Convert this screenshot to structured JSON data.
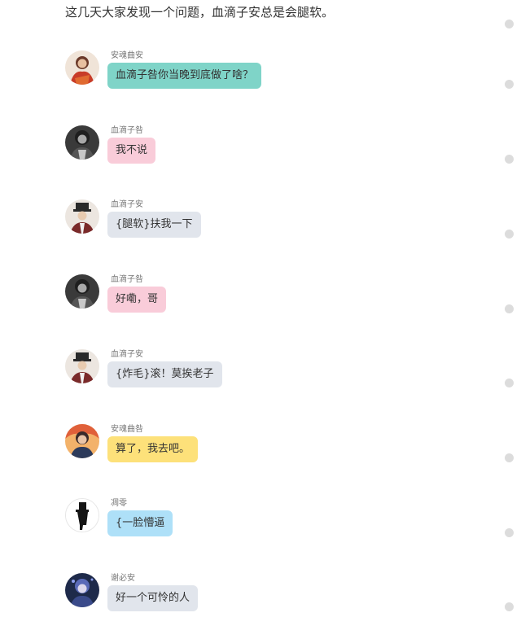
{
  "intro_text": "这几天大家发现一个问题，血滴子安总是会腿软。",
  "messages": [
    {
      "name": "安魂曲安",
      "text": "血滴子咎你当晚到底做了啥？",
      "bubble_color": "#7fd4c8",
      "avatar": "red-warrior-avatar-icon"
    },
    {
      "name": "血滴子咎",
      "text": "我不说",
      "bubble_color": "#f9ccd9",
      "avatar": "dark-figure-avatar-icon"
    },
    {
      "name": "血滴子安",
      "text": "{腿软}扶我一下",
      "bubble_color": "#e1e5ec",
      "avatar": "hat-figure-avatar-icon"
    },
    {
      "name": "血滴子咎",
      "text": "好嘞，哥",
      "bubble_color": "#f9ccd9",
      "avatar": "dark-figure-avatar-icon"
    },
    {
      "name": "血滴子安",
      "text": "{炸毛}滚！莫挨老子",
      "bubble_color": "#e1e5ec",
      "avatar": "hat-figure-avatar-icon"
    },
    {
      "name": "安魂曲咎",
      "text": "算了，我去吧。",
      "bubble_color": "#fde17a",
      "avatar": "fiery-figure-avatar-icon"
    },
    {
      "name": "凋零",
      "text": "{一脸懵逼",
      "bubble_color": "#aee0f8",
      "avatar": "silhouette-avatar-icon"
    },
    {
      "name": "谢必安",
      "text": "好一个可怜的人",
      "bubble_color": "#e1e5ec",
      "avatar": "blue-haired-avatar-icon"
    }
  ]
}
